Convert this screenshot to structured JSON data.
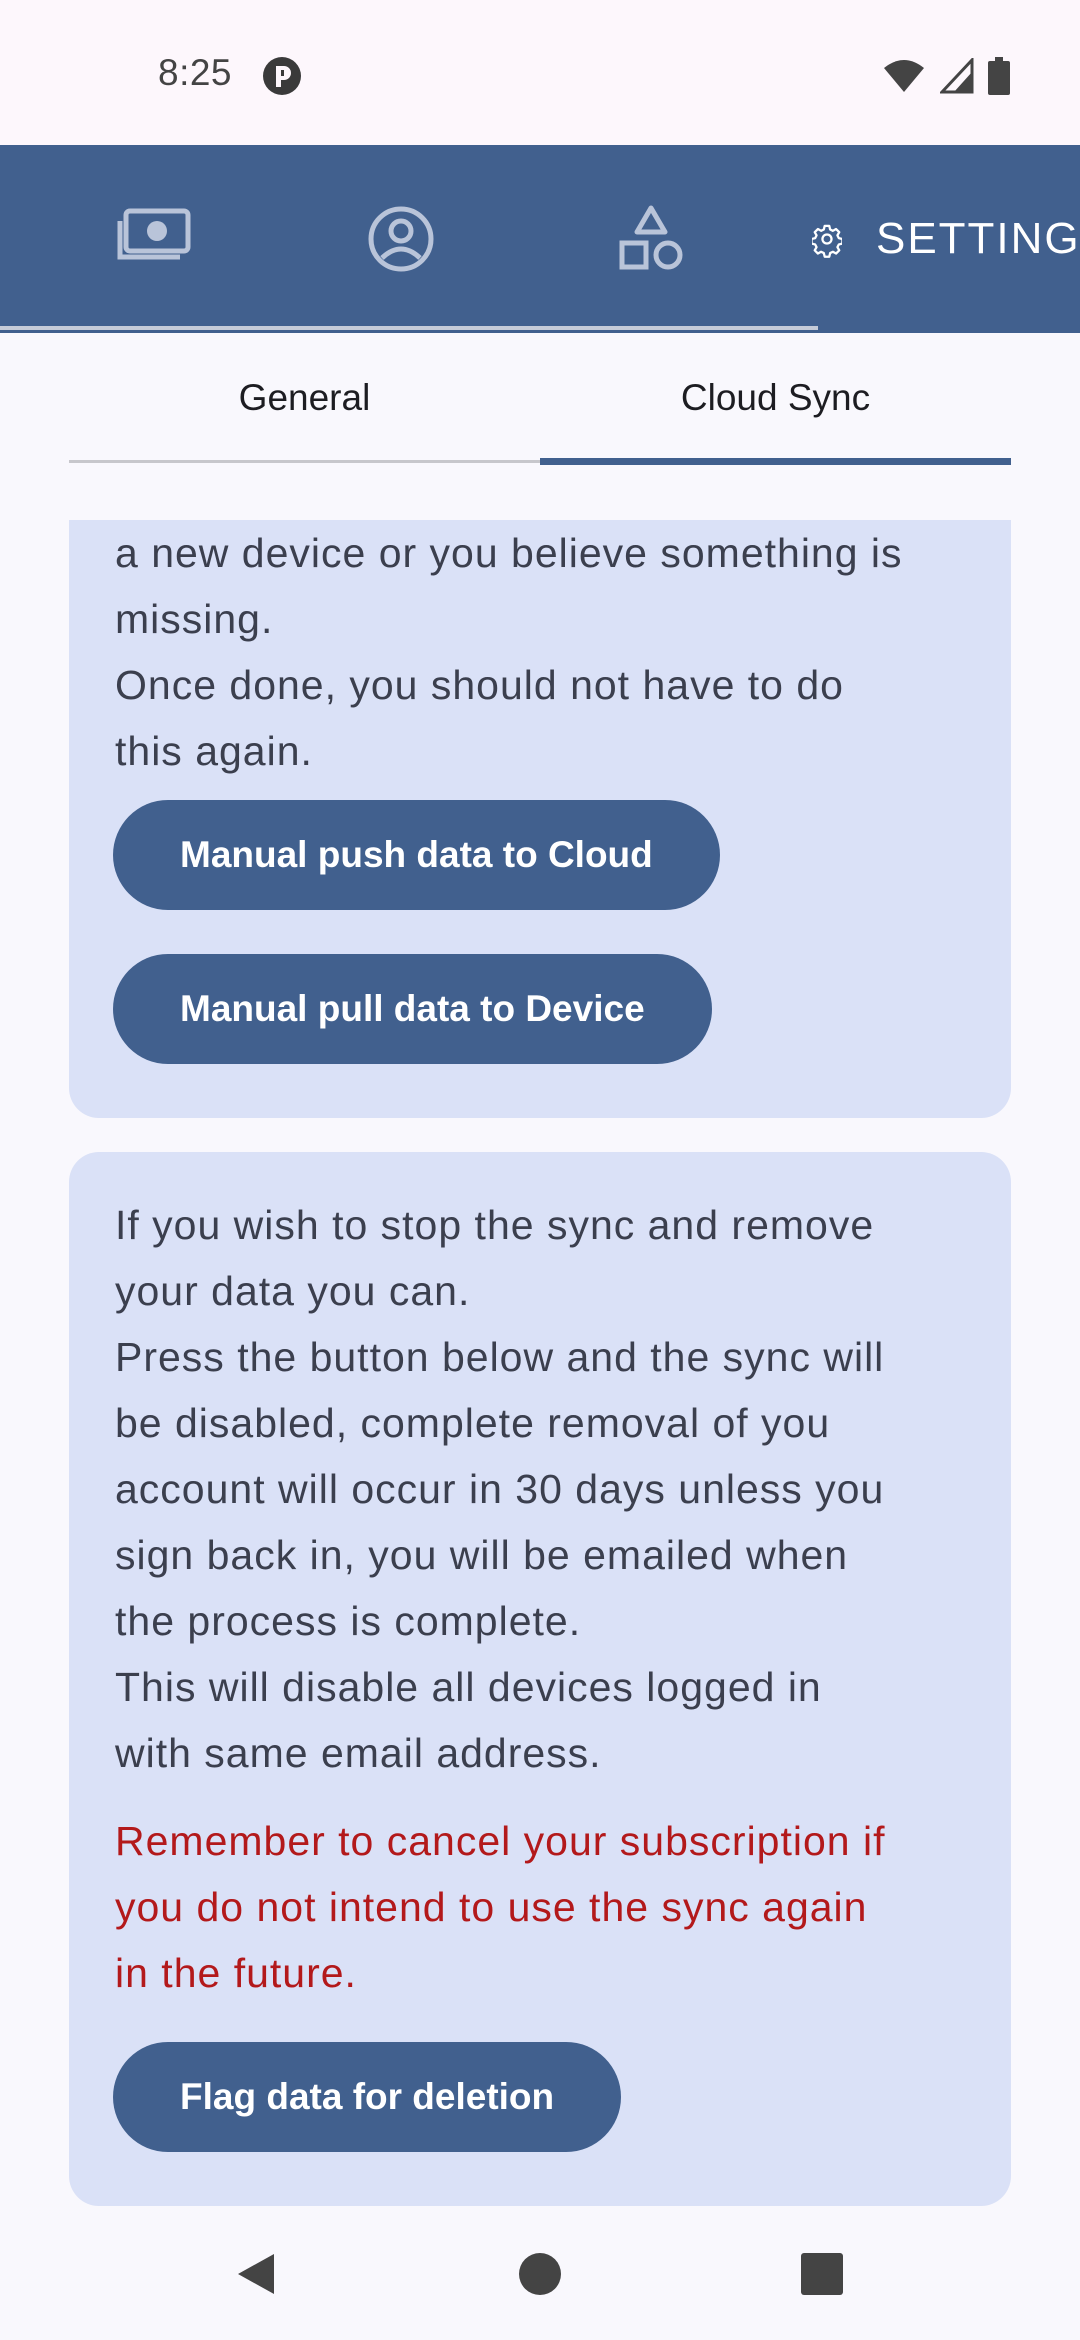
{
  "status_bar": {
    "time": "8:25",
    "icons": [
      "app-notification-icon",
      "wifi-icon",
      "signal-icon",
      "battery-icon"
    ]
  },
  "top_nav": {
    "tabs": [
      {
        "icon": "money-icon"
      },
      {
        "icon": "account-icon"
      },
      {
        "icon": "shapes-icon"
      },
      {
        "icon": "gear-icon",
        "label": "SETTINGS"
      }
    ],
    "background": "#41608e"
  },
  "sub_tabs": {
    "items": [
      {
        "label": "General"
      },
      {
        "label": "Cloud Sync"
      }
    ],
    "active": "Cloud Sync"
  },
  "sync_card": {
    "text_lines": [
      "a new device or you believe something is",
      "missing.",
      "Once done, you should not have to do",
      "this again."
    ],
    "push_button": "Manual push data to Cloud",
    "pull_button": "Manual pull data to Device"
  },
  "delete_card": {
    "text_lines": [
      "If you wish to stop the sync and remove",
      "your data you can.",
      "Press the button below and the sync will",
      "be disabled, complete removal of you",
      "account will occur in 30 days unless you",
      "sign back in, you will be emailed when",
      "the process is complete.",
      "This will disable all devices logged in",
      "with same email address."
    ],
    "warning_lines": [
      "Remember to cancel your subscription if",
      "you do not intend to use the sync again",
      "in the future."
    ],
    "delete_button": "Flag data for deletion"
  },
  "colors": {
    "accent": "#41608e",
    "card": "#dae1f7",
    "warning": "#b3191b"
  }
}
